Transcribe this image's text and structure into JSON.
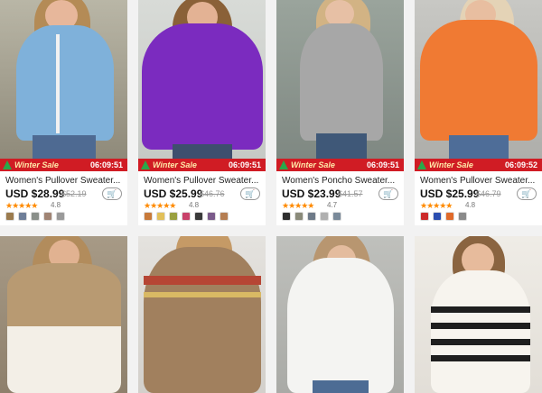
{
  "top_row": [
    {
      "banner_label": "Winter Sale",
      "timer": "06:09:51",
      "title": "Women's Pullover Sweater...",
      "price": "USD $28.99",
      "old_price": "$52.19",
      "stars": "★★★★★",
      "rating": "4.8",
      "swatches": [
        "#9b7b4e",
        "#6e7e98",
        "#8a8f8a",
        "#a08474",
        "#9a9a9a"
      ]
    },
    {
      "banner_label": "Winter Sale",
      "timer": "06:09:51",
      "title": "Women's Pullover Sweater...",
      "price": "USD $25.99",
      "old_price": "$46.76",
      "stars": "★★★★★",
      "rating": "4.8",
      "swatches": [
        "#c87a3a",
        "#e2c05a",
        "#9aa040",
        "#c9426a",
        "#3a3a3a",
        "#7a5a8a",
        "#b57e52"
      ]
    },
    {
      "banner_label": "Winter Sale",
      "timer": "06:09:51",
      "title": "Women's Poncho Sweater...",
      "price": "USD $23.99",
      "old_price": "$41.57",
      "stars": "★★★★★",
      "rating": "4.7",
      "swatches": [
        "#2e2e2e",
        "#8a8a7a",
        "#6e7a88",
        "#b0b0b0",
        "#7a8a9a"
      ]
    },
    {
      "banner_label": "Winter Sale",
      "timer": "06:09:52",
      "title": "Women's Pullover Sweater...",
      "price": "USD $25.99",
      "old_price": "$46.79",
      "stars": "★★★★★",
      "rating": "4.8",
      "swatches": [
        "#cc2a2a",
        "#2b4eb0",
        "#e06a2a",
        "#8a8a8a"
      ]
    }
  ],
  "bottom_row": [
    {},
    {},
    {},
    {}
  ],
  "icons": {
    "cart": "cart-icon",
    "tree": "christmas-tree-icon"
  },
  "colors": {
    "banner": "#d01c24",
    "star": "#ff8a00"
  }
}
